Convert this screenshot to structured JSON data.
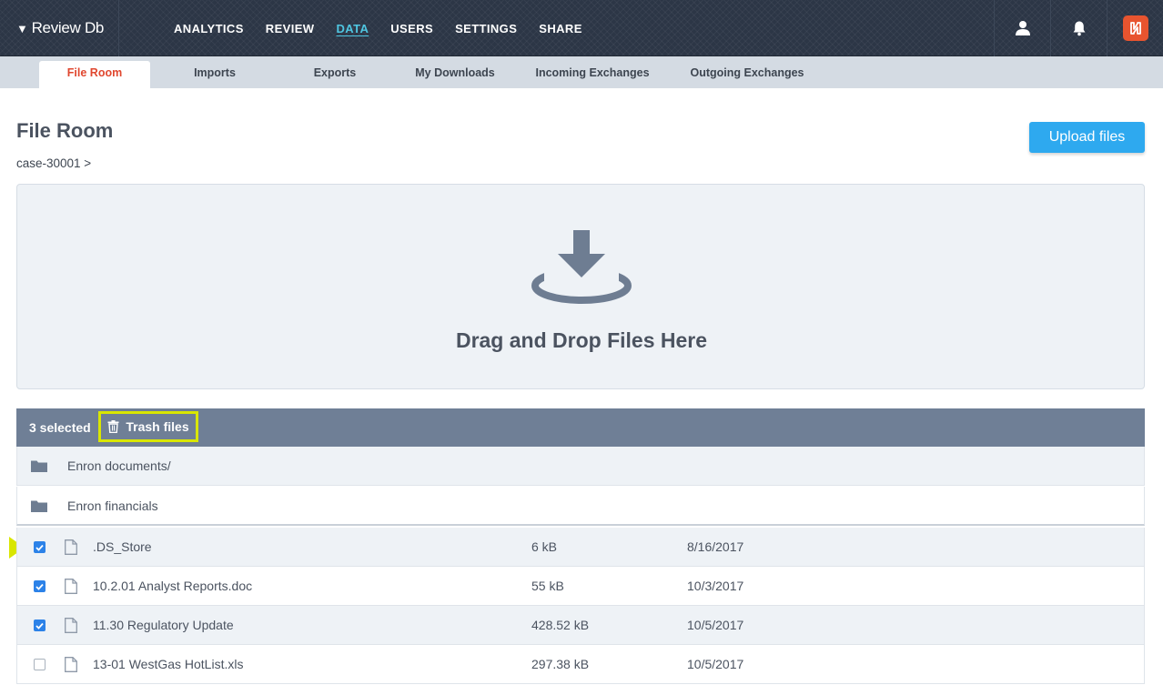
{
  "topbar": {
    "brand": "Review Db",
    "brand_caret": "▼",
    "nav": [
      {
        "label": "ANALYTICS"
      },
      {
        "label": "REVIEW"
      },
      {
        "label": "DATA",
        "active": true
      },
      {
        "label": "USERS"
      },
      {
        "label": "SETTINGS"
      },
      {
        "label": "SHARE"
      }
    ],
    "icons": [
      "user-icon",
      "bell-icon",
      "app-logo-icon"
    ],
    "logo_color": "#e8542f"
  },
  "subnav": {
    "tabs": [
      {
        "label": "File Room",
        "active": true
      },
      {
        "label": "Imports"
      },
      {
        "label": "Exports"
      },
      {
        "label": "My Downloads"
      },
      {
        "label": "Incoming Exchanges"
      },
      {
        "label": "Outgoing Exchanges"
      }
    ]
  },
  "page": {
    "title": "File Room",
    "breadcrumb": "case-30001 >",
    "upload_label": "Upload files"
  },
  "dropzone": {
    "text": "Drag and Drop Files Here",
    "icon": "download-tray-icon"
  },
  "table": {
    "selected_text": "3 selected",
    "trash_label": "Trash files",
    "folders": [
      {
        "name": "Enron documents/"
      },
      {
        "name": "Enron financials"
      }
    ],
    "files": [
      {
        "name": ".DS_Store",
        "size": "6 kB",
        "date": "8/16/2017",
        "checked": true
      },
      {
        "name": "10.2.01 Analyst Reports.doc",
        "size": "55 kB",
        "date": "10/3/2017",
        "checked": true
      },
      {
        "name": "11.30 Regulatory Update",
        "size": "428.52 kB",
        "date": "10/5/2017",
        "checked": true
      },
      {
        "name": "13-01 WestGas HotList.xls",
        "size": "297.38 kB",
        "date": "10/5/2017",
        "checked": false
      }
    ]
  },
  "colors": {
    "accent": "#2ea9ef",
    "active_nav": "#4fc6e1",
    "active_tab": "#e0472f",
    "highlight": "#d9e600",
    "header_bar": "#6f7f96"
  }
}
